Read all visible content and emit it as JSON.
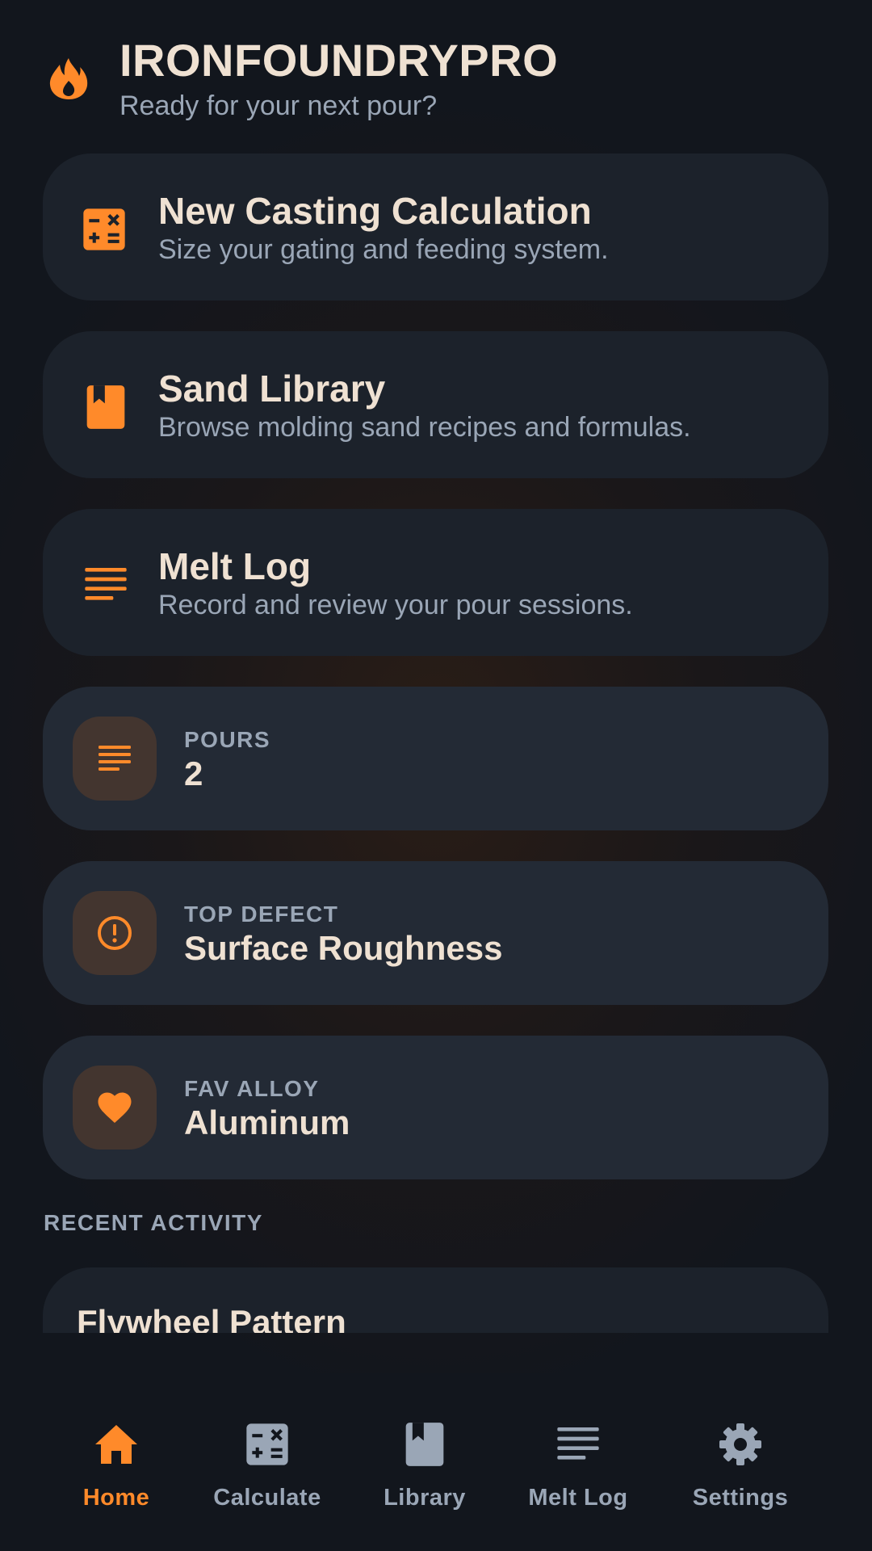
{
  "colors": {
    "accent": "#ff8a2a",
    "text_primary": "#efe1d2",
    "text_secondary": "#9aa6b6",
    "card_bg": "#1c222b",
    "stat_card_bg": "#232a35",
    "background": "#12161d"
  },
  "header": {
    "icon": "flame-icon",
    "title": "IRONFOUNDRYPRO",
    "subtitle": "Ready for your next pour?"
  },
  "actions": [
    {
      "icon": "calculator-icon",
      "title": "New Casting Calculation",
      "description": "Size your gating and feeding system."
    },
    {
      "icon": "book-icon",
      "title": "Sand Library",
      "description": "Browse molding sand recipes and formulas."
    },
    {
      "icon": "notes-icon",
      "title": "Melt Log",
      "description": "Record and review your pour sessions."
    }
  ],
  "stats": [
    {
      "icon": "notes-icon",
      "label": "POURS",
      "value": "2"
    },
    {
      "icon": "alert-circle-icon",
      "label": "TOP DEFECT",
      "value": "Surface Roughness"
    },
    {
      "icon": "heart-icon",
      "label": "FAV ALLOY",
      "value": "Aluminum"
    }
  ],
  "recent": {
    "section_label": "RECENT ACTIVITY",
    "items": [
      {
        "title": "Flywheel Pattern"
      }
    ]
  },
  "nav": {
    "active": "Home",
    "items": [
      {
        "icon": "home-icon",
        "label": "Home"
      },
      {
        "icon": "calculator-icon",
        "label": "Calculate"
      },
      {
        "icon": "book-icon",
        "label": "Library"
      },
      {
        "icon": "notes-icon",
        "label": "Melt Log"
      },
      {
        "icon": "gear-icon",
        "label": "Settings"
      }
    ]
  }
}
